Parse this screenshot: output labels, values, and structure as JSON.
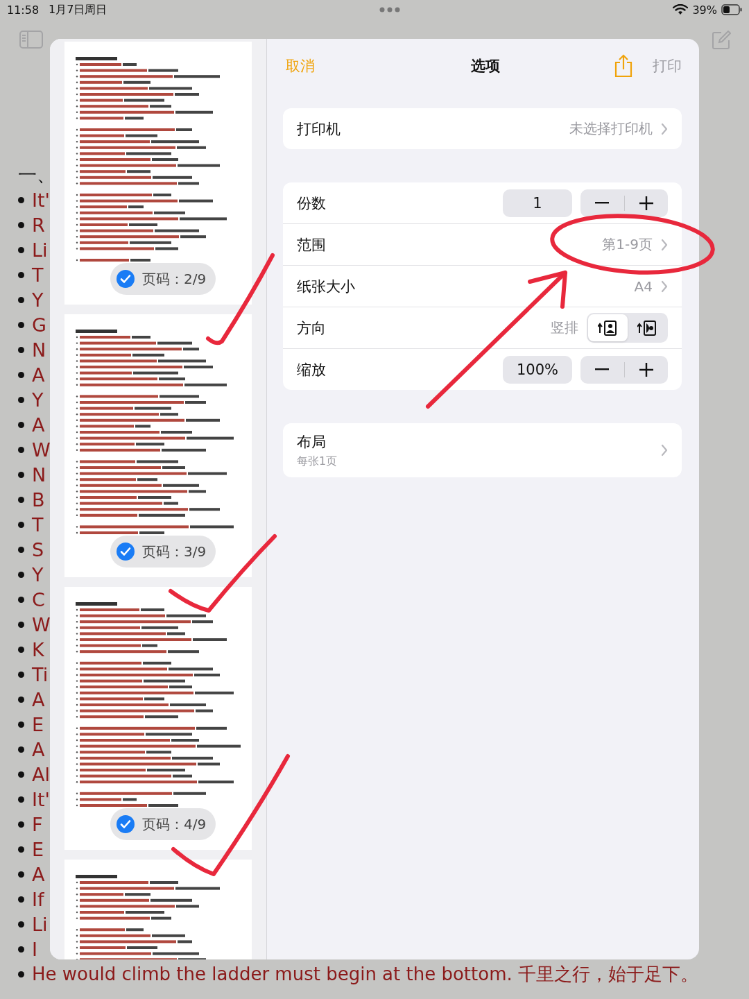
{
  "status_bar": {
    "time": "11:58",
    "date": "1月7日周日",
    "battery": "39%"
  },
  "note": {
    "heading": "一、",
    "lines": [
      "It'",
      "R",
      "Li",
      "T",
      "Y",
      "G",
      "N",
      "A",
      "Y",
      "A",
      "W",
      "N",
      "B",
      "T",
      "S",
      "Y",
      "C",
      "W",
      "K",
      "Ti",
      "A",
      "E",
      "A",
      "Al",
      "It'",
      "F",
      "E",
      "A",
      "If",
      "Li",
      "I"
    ],
    "last_line": "He would climb the ladder must begin at the bottom. 千里之行，始于足下。"
  },
  "print_dialog": {
    "cancel": "取消",
    "title": "选项",
    "print": "打印",
    "print_disabled": true,
    "pages": [
      {
        "kind": "badged",
        "badge": "页码：2/9",
        "selected": true
      },
      {
        "kind": "badged",
        "badge": "页码：3/9",
        "selected": true
      },
      {
        "kind": "badged",
        "badge": "页码：4/9",
        "selected": true
      },
      {
        "kind": "plain"
      }
    ],
    "printer": {
      "label": "打印机",
      "value": "未选择打印机"
    },
    "settings": [
      {
        "kind": "stepper",
        "label": "份数",
        "value": "1"
      },
      {
        "kind": "link",
        "label": "范围",
        "value": "第1-9页"
      },
      {
        "kind": "link",
        "label": "纸张大小",
        "value": "A4"
      },
      {
        "kind": "orientation",
        "label": "方向",
        "value": "竖排",
        "options": [
          {
            "selected": true
          },
          {
            "selected": false
          }
        ]
      },
      {
        "kind": "stepper",
        "label": "缩放",
        "value": "100%"
      }
    ],
    "layout": {
      "label": "布局",
      "detail": "每张1页"
    }
  }
}
